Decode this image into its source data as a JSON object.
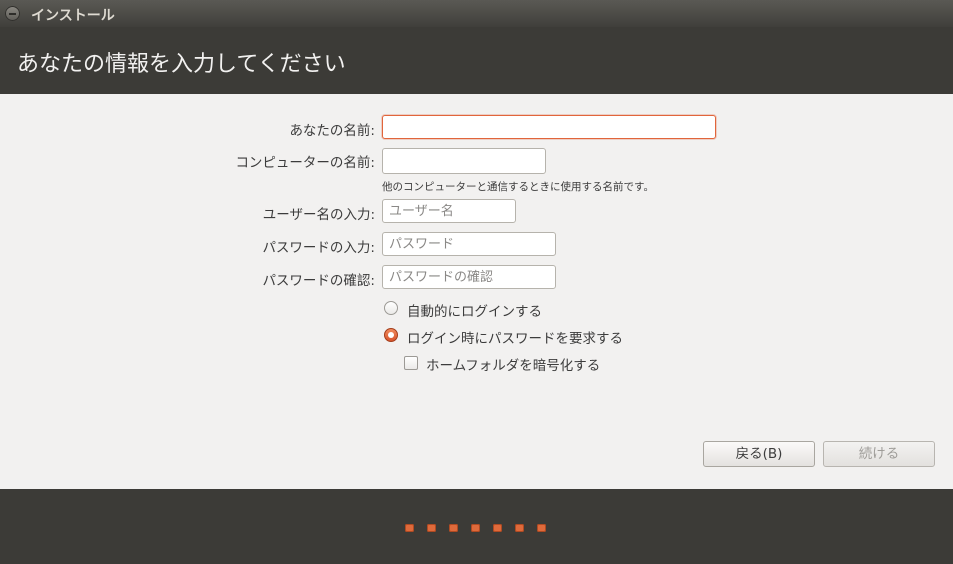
{
  "window": {
    "title": "インストール",
    "icon": "close-icon"
  },
  "header": {
    "title": "あなたの情報を入力してください"
  },
  "form": {
    "name_label": "あなたの名前:",
    "name_value": "",
    "computer_label": "コンピューターの名前:",
    "computer_value": "",
    "computer_hint": "他のコンピューターと通信するときに使用する名前です。",
    "user_label": "ユーザー名の入力:",
    "user_placeholder": "ユーザー名",
    "password_label": "パスワードの入力:",
    "password_placeholder": "パスワード",
    "confirm_label": "パスワードの確認:",
    "confirm_placeholder": "パスワードの確認"
  },
  "options": {
    "auto_login": "自動的にログインする",
    "require_password": "ログイン時にパスワードを要求する",
    "selected": "require_password",
    "encrypt_home": "ホームフォルダを暗号化する",
    "encrypt_home_checked": false
  },
  "buttons": {
    "back": "戻る(B)",
    "continue": "続ける"
  },
  "progress": {
    "step_count": 7
  },
  "colors": {
    "accent": "#e1653b",
    "header_bg": "#3c3b37",
    "body_bg": "#f2f1f0"
  }
}
